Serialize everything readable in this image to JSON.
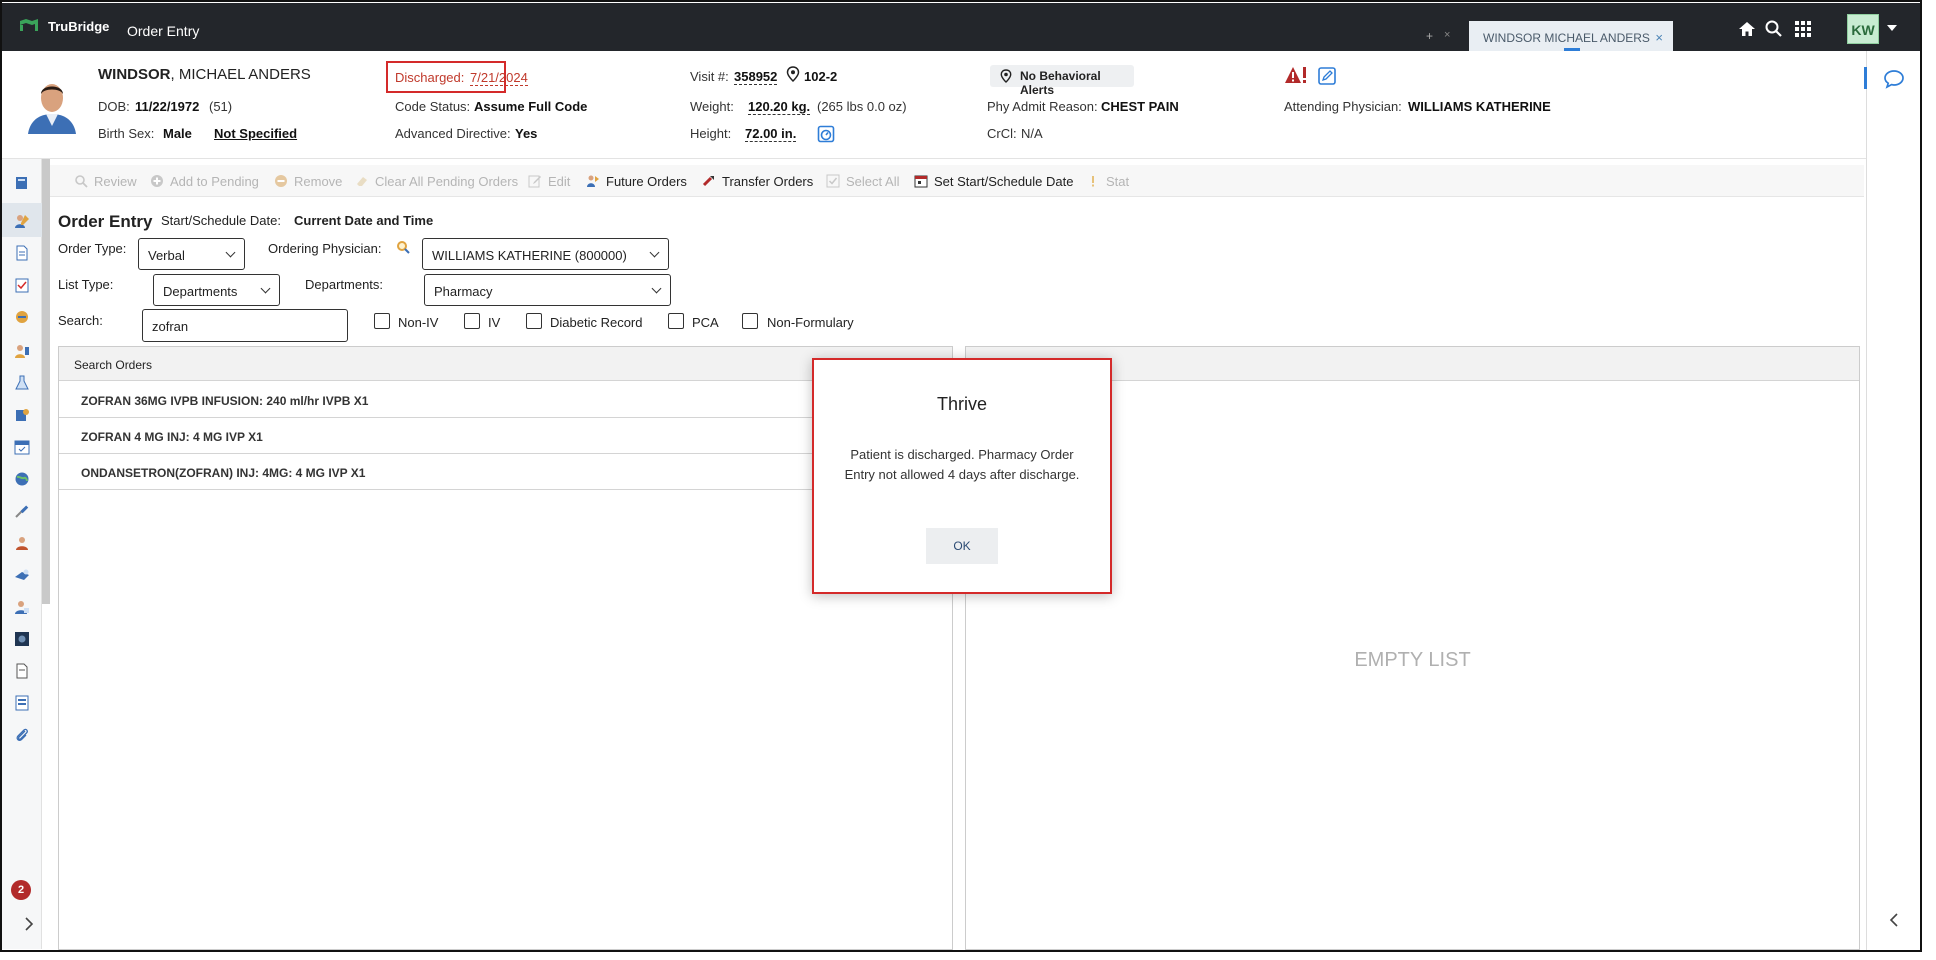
{
  "topbar": {
    "brand": "TruBridge",
    "app_title": "Order Entry",
    "tab_plus": "+",
    "tab_close_small": "×",
    "patient_tab": "WINDSOR MICHAEL ANDERS",
    "patient_tab_close": "×",
    "user_initials": "KW"
  },
  "patient": {
    "last_name": "WINDSOR",
    "rest_name": ", MICHAEL ANDERS",
    "dob_label": "DOB:",
    "dob": "11/22/1972",
    "age": "(51)",
    "sex_label": "Birth Sex:",
    "sex": "Male",
    "not_specified": "Not Specified",
    "discharged_label": "Discharged:",
    "discharged_date": "7/21/2024",
    "code_label": "Code Status:",
    "code": "Assume Full Code",
    "adv_label": "Advanced Directive:",
    "adv": "Yes",
    "visit_label": "Visit #:",
    "visit": "358952",
    "room": "102-2",
    "weight_label": "Weight:",
    "weight": "120.20 kg.",
    "weight_alt": "(265 lbs 0.0 oz)",
    "height_label": "Height:",
    "height": "72.00 in.",
    "behavioral": "No Behavioral Alerts",
    "admit_label": "Phy Admit Reason:",
    "admit": "CHEST PAIN",
    "crcl_label": "CrCl:",
    "crcl": "N/A",
    "attending_label": "Attending Physician:",
    "attending": "WILLIAMS KATHERINE"
  },
  "toolbar": {
    "review": "Review",
    "add_pending": "Add to Pending",
    "remove": "Remove",
    "clear_pending": "Clear All Pending Orders",
    "edit": "Edit",
    "future": "Future Orders",
    "transfer": "Transfer Orders",
    "select_all": "Select All",
    "set_start": "Set Start/Schedule Date",
    "stat": "Stat"
  },
  "form": {
    "title": "Order Entry",
    "start_label": "Start/Schedule Date:",
    "start_value": "Current Date and Time",
    "order_type_label": "Order Type:",
    "order_type": "Verbal",
    "ordering_physician_label": "Ordering Physician:",
    "ordering_physician": "WILLIAMS KATHERINE (800000)",
    "list_type_label": "List Type:",
    "list_type": "Departments",
    "departments_label": "Departments:",
    "department": "Pharmacy",
    "search_label": "Search:",
    "search_value": "zofran",
    "filters": [
      "Non-IV",
      "IV",
      "Diabetic Record",
      "PCA",
      "Non-Formulary"
    ]
  },
  "search_orders": {
    "header": "Search Orders",
    "rows": [
      "ZOFRAN 36MG IVPB INFUSION: 240 ml/hr IVPB X1",
      "ZOFRAN 4 MG INJ: 4 MG IVP X1",
      "ONDANSETRON(ZOFRAN) INJ: 4MG: 4 MG IVP X1"
    ]
  },
  "pending_panel": {
    "empty": "EMPTY LIST"
  },
  "modal": {
    "title": "Thrive",
    "message": "Patient is discharged. Pharmacy Order Entry not allowed 4 days after discharge.",
    "ok": "OK"
  },
  "left_rail": {
    "badge_count": "2"
  },
  "colors": {
    "topbar": "#23262b",
    "alert_red": "#d42a2a",
    "accent_blue": "#2e7dd7"
  }
}
